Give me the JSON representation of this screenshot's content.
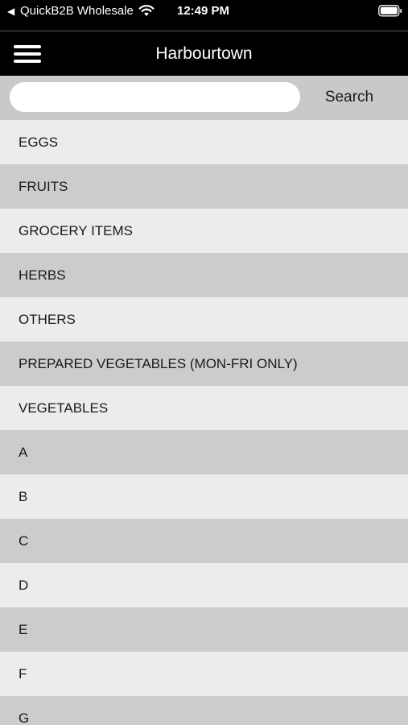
{
  "status_bar": {
    "back_glyph": "◀",
    "app_name": "QuickB2B Wholesale",
    "time": "12:49 PM",
    "icons": [
      "wifi-icon",
      "battery-icon"
    ]
  },
  "header": {
    "title": "Harbourtown",
    "menu_icon": "hamburger-menu-icon"
  },
  "search": {
    "placeholder": "",
    "value": "",
    "button_label": "Search"
  },
  "categories": [
    "EGGS",
    "FRUITS",
    "GROCERY ITEMS",
    "HERBS",
    "OTHERS",
    "PREPARED VEGETABLES (MON-FRI ONLY)",
    "VEGETABLES",
    "A",
    "B",
    "C",
    "D",
    "E",
    "F",
    "G"
  ],
  "colors": {
    "navbar_bg": "#000000",
    "searchbar_bg": "#c9c9c9",
    "row_light": "#ececec",
    "row_dark": "#cccccc"
  }
}
